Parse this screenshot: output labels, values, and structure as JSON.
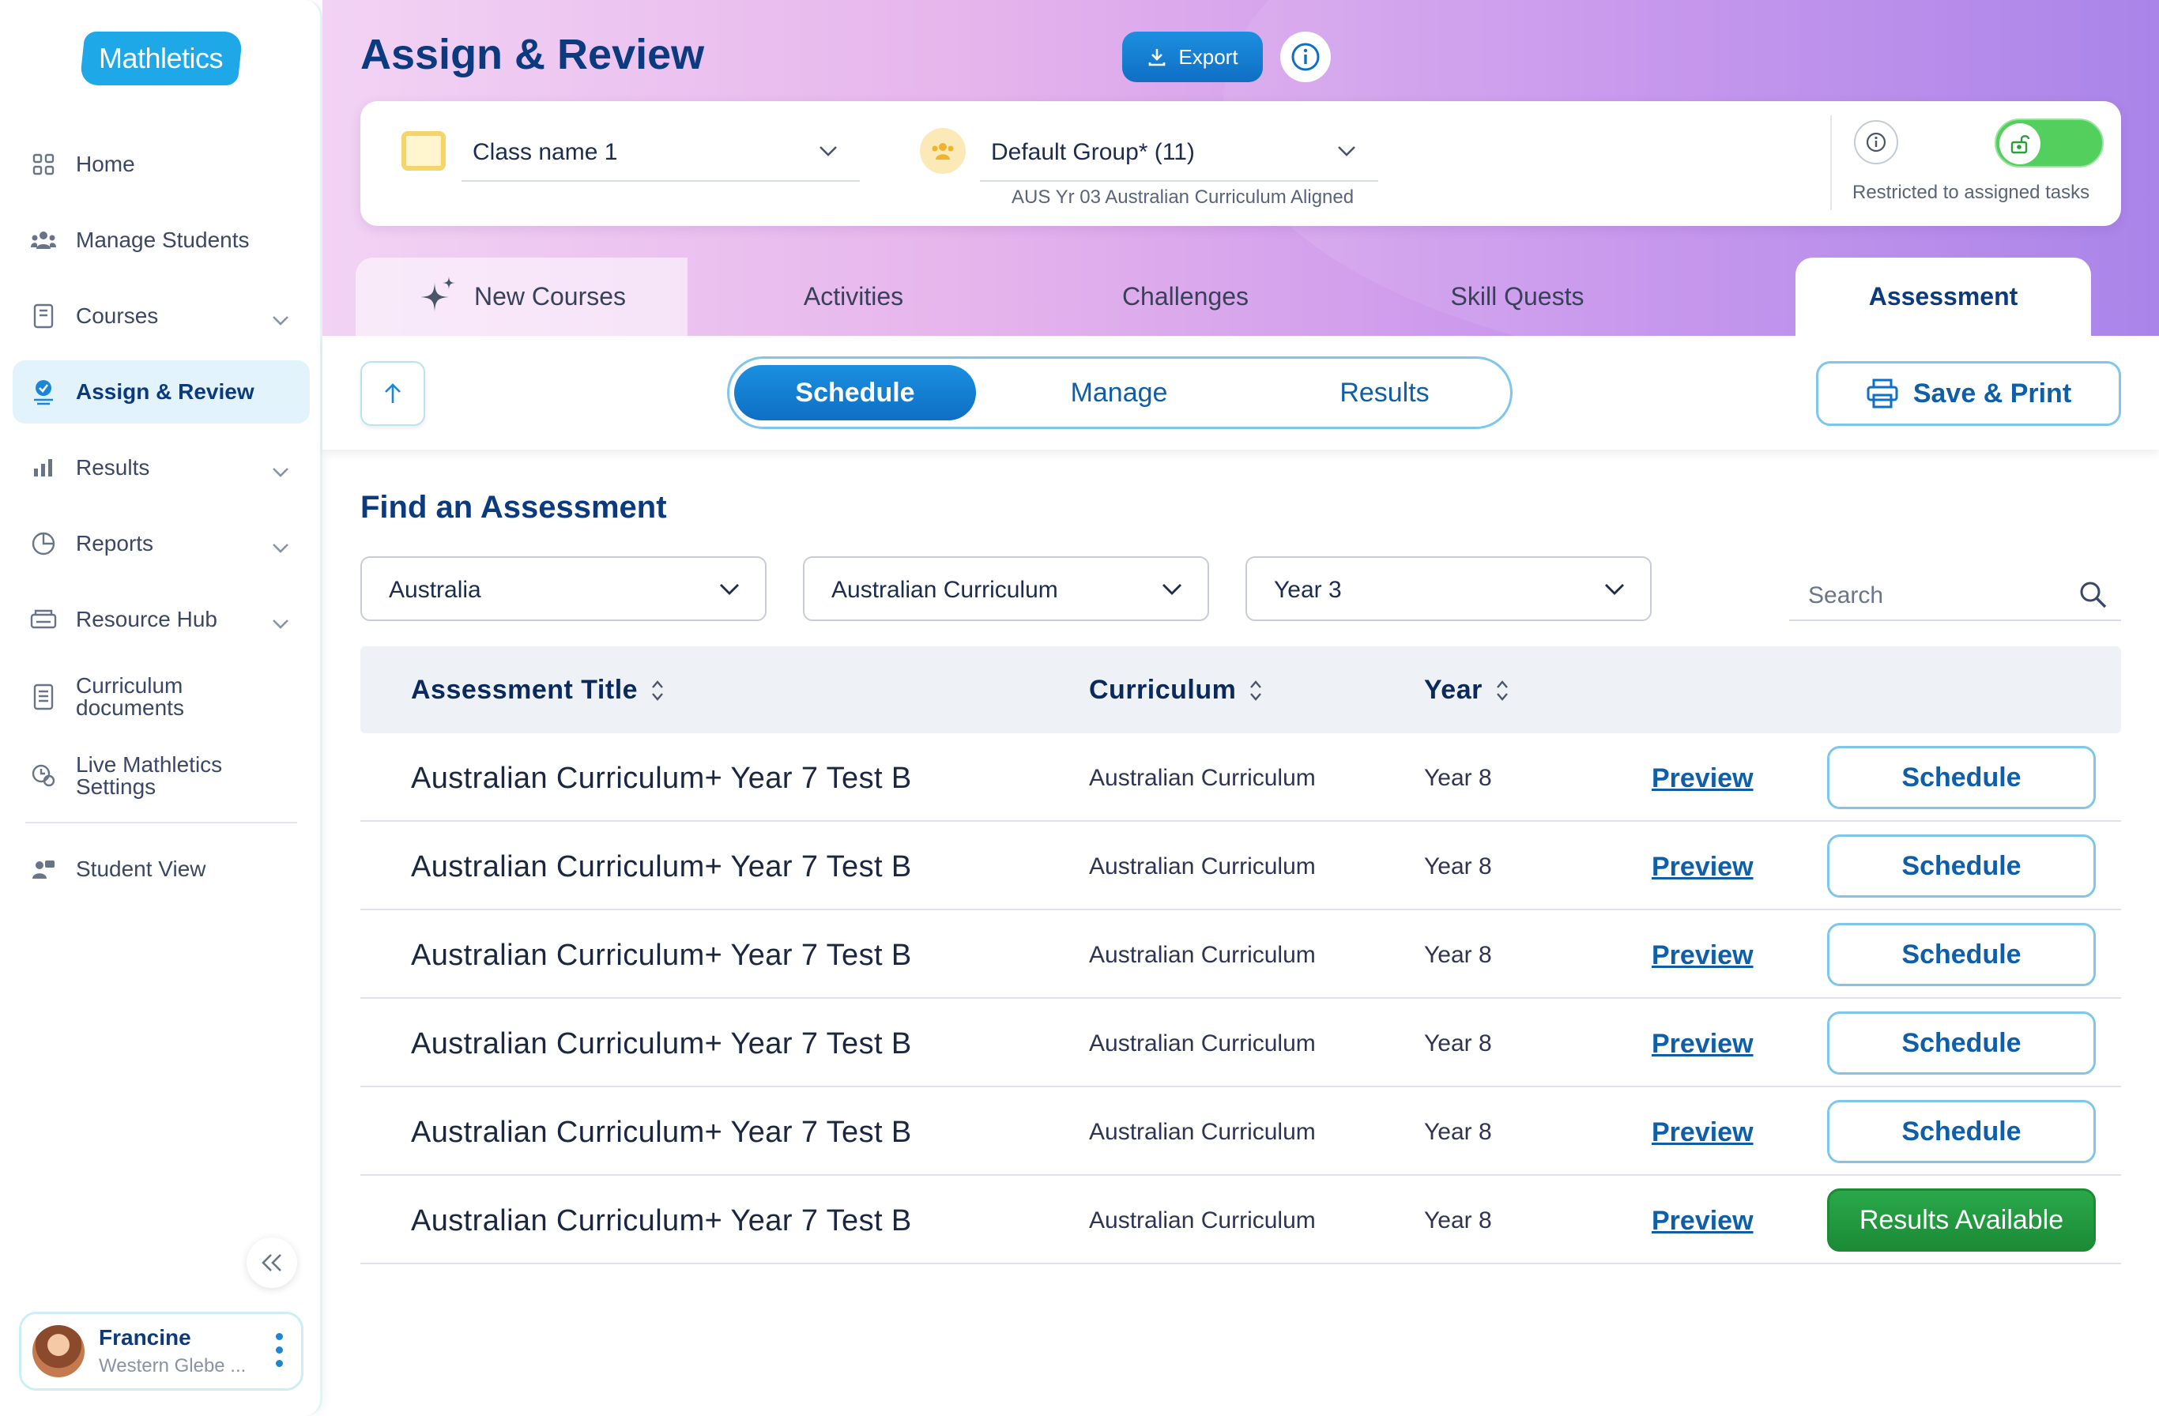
{
  "app": {
    "logo_text": "Mathletics"
  },
  "sidebar": {
    "items": [
      {
        "label": "Home",
        "icon": "grid-icon",
        "has_chevron": false
      },
      {
        "label": "Manage Students",
        "icon": "students-icon",
        "has_chevron": false
      },
      {
        "label": "Courses",
        "icon": "book-icon",
        "has_chevron": true
      },
      {
        "label": "Assign & Review",
        "icon": "assign-check-icon",
        "has_chevron": false,
        "active": true
      },
      {
        "label": "Results",
        "icon": "bar-chart-icon",
        "has_chevron": true
      },
      {
        "label": "Reports",
        "icon": "pie-chart-icon",
        "has_chevron": true
      },
      {
        "label": "Resource Hub",
        "icon": "printer-tray-icon",
        "has_chevron": true
      },
      {
        "label": "Curriculum documents",
        "icon": "document-icon",
        "has_chevron": false
      },
      {
        "label": "Live Mathletics Settings",
        "icon": "live-settings-icon",
        "has_chevron": false
      },
      {
        "label": "Student View",
        "icon": "student-view-icon",
        "has_chevron": false
      }
    ],
    "user": {
      "name": "Francine",
      "school": "Western Glebe ..."
    }
  },
  "header": {
    "title": "Assign & Review",
    "export_label": "Export",
    "class_name": "Class name 1",
    "group_name": "Default Group* (11)",
    "group_curriculum": "AUS Yr 03 Australian Curriculum Aligned",
    "restricted_label": "Restricted to assigned tasks",
    "restricted_on": true
  },
  "tabs": [
    {
      "label": "New Courses"
    },
    {
      "label": "Activities"
    },
    {
      "label": "Challenges"
    },
    {
      "label": "Skill Quests"
    },
    {
      "label": "Assessment",
      "active": true
    }
  ],
  "subnav": {
    "options": [
      "Schedule",
      "Manage",
      "Results"
    ],
    "active": "Schedule",
    "save_print_label": "Save & Print"
  },
  "find": {
    "title": "Find an Assessment",
    "filters": [
      "Australia",
      "Australian Curriculum",
      "Year 3"
    ],
    "search_placeholder": "Search"
  },
  "table": {
    "headers": {
      "title": "Assessment Title",
      "curriculum": "Curriculum",
      "year": "Year"
    },
    "rows": [
      {
        "title": "Australian Curriculum+ Year 7 Test B",
        "curriculum": "Australian Curriculum",
        "year": "Year 8",
        "preview": "Preview",
        "action": "Schedule"
      },
      {
        "title": "Australian Curriculum+ Year 7 Test B",
        "curriculum": "Australian Curriculum",
        "year": "Year 8",
        "preview": "Preview",
        "action": "Schedule"
      },
      {
        "title": "Australian Curriculum+ Year 7 Test B",
        "curriculum": "Australian Curriculum",
        "year": "Year 8",
        "preview": "Preview",
        "action": "Schedule"
      },
      {
        "title": "Australian Curriculum+ Year 7 Test B",
        "curriculum": "Australian Curriculum",
        "year": "Year 8",
        "preview": "Preview",
        "action": "Schedule"
      },
      {
        "title": "Australian Curriculum+ Year 7 Test B",
        "curriculum": "Australian Curriculum",
        "year": "Year 8",
        "preview": "Preview",
        "action": "Schedule"
      },
      {
        "title": "Australian Curriculum+ Year 7 Test B",
        "curriculum": "Australian Curriculum",
        "year": "Year 8",
        "preview": "Preview",
        "action": "Results Available"
      }
    ]
  },
  "colors": {
    "brand": "#1ea8e8",
    "primary": "#0f6fc4",
    "title": "#0b3a7e",
    "success": "#1b8b36",
    "toggle_on": "#52cf5d"
  }
}
